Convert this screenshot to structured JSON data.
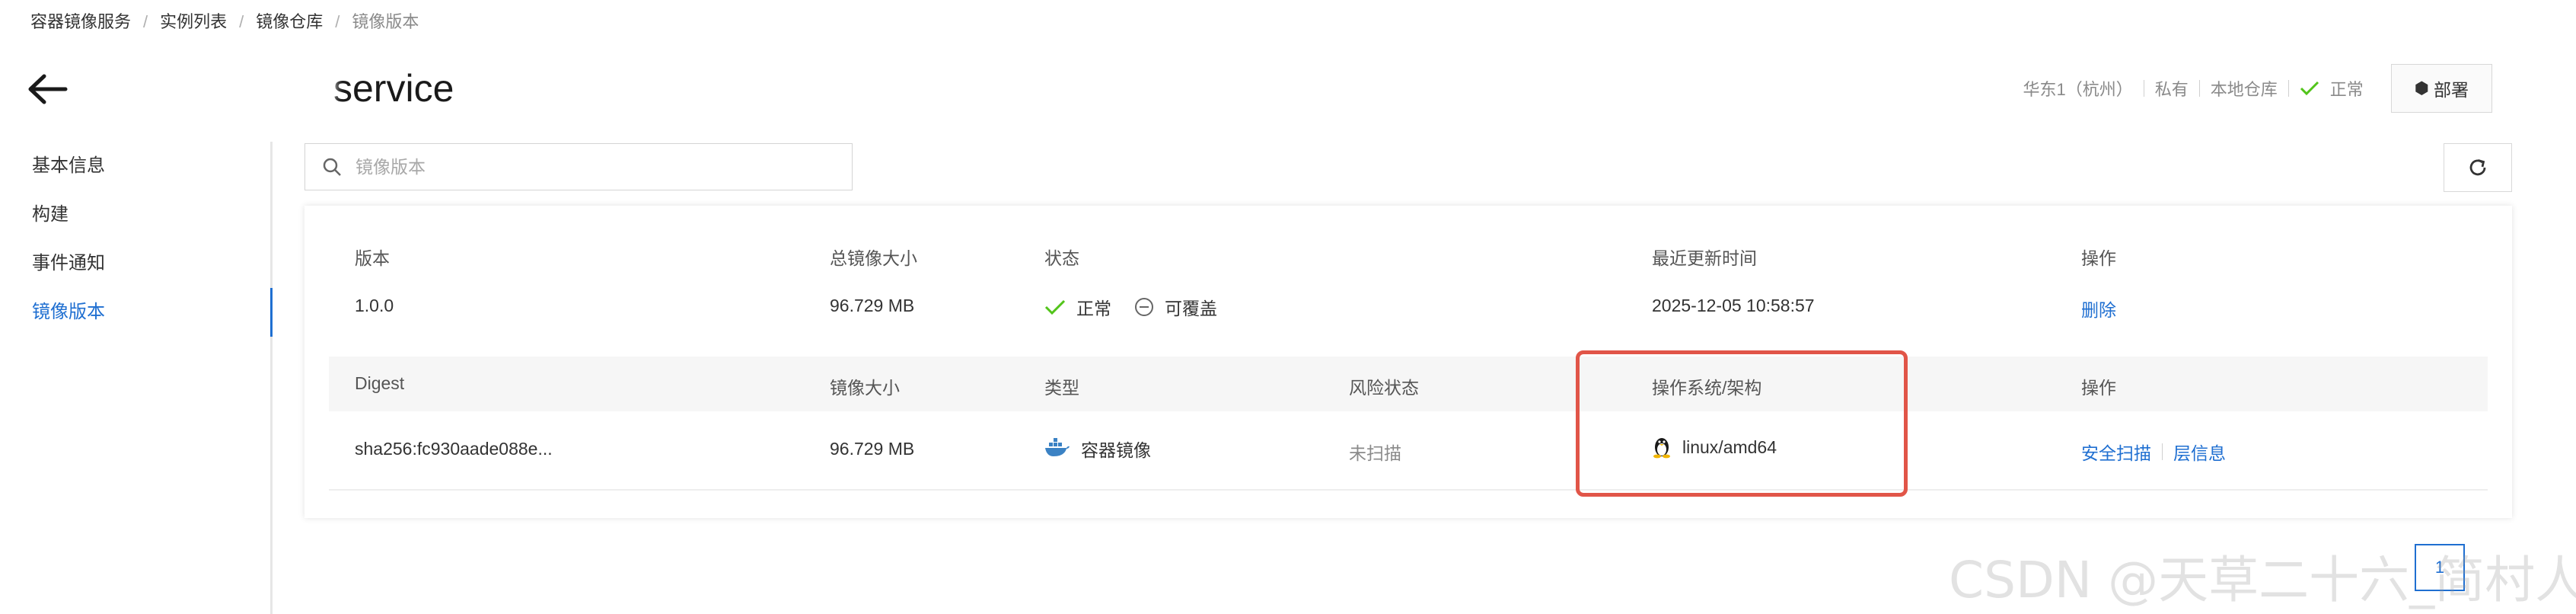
{
  "breadcrumb": {
    "items": [
      "容器镜像服务",
      "实例列表",
      "镜像仓库"
    ],
    "current": "镜像版本",
    "separator": "/"
  },
  "header": {
    "title": "service",
    "region": "华东1（杭州）",
    "visibility": "私有",
    "repo_source": "本地仓库",
    "status": "正常",
    "deploy_label": "部署"
  },
  "sidebar": {
    "items": [
      {
        "label": "基本信息"
      },
      {
        "label": "构建"
      },
      {
        "label": "事件通知"
      },
      {
        "label": "镜像版本"
      }
    ]
  },
  "search": {
    "placeholder": "镜像版本"
  },
  "versions_table": {
    "headers": {
      "version": "版本",
      "total_size": "总镜像大小",
      "status": "状态",
      "updated": "最近更新时间",
      "actions": "操作"
    },
    "row": {
      "version": "1.0.0",
      "total_size": "96.729 MB",
      "status": "正常",
      "overwrite": "可覆盖",
      "updated": "2025-12-05 10:58:57",
      "delete": "删除"
    }
  },
  "digest_table": {
    "headers": {
      "digest": "Digest",
      "size": "镜像大小",
      "type": "类型",
      "risk": "风险状态",
      "os_arch": "操作系统/架构",
      "actions": "操作"
    },
    "row": {
      "digest": "sha256:fc930aade088e...",
      "size": "96.729 MB",
      "type": "容器镜像",
      "risk": "未扫描",
      "os_arch": "linux/amd64",
      "scan": "安全扫描",
      "layers": "层信息"
    }
  },
  "pagination": {
    "current": "1"
  },
  "watermark": "CSDN @天草二十六_简村人",
  "colors": {
    "accent": "#1f6fd1",
    "success": "#52c41a",
    "highlight": "#e15548"
  }
}
